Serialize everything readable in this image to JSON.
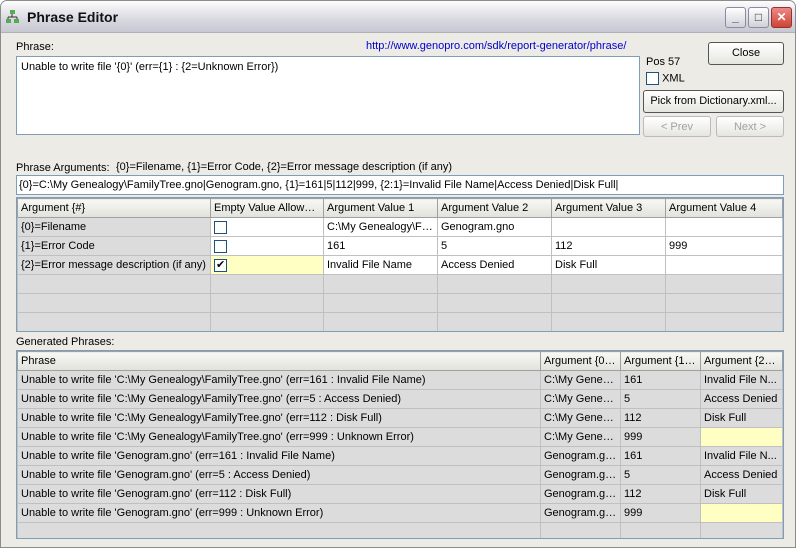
{
  "window": {
    "title": "Phrase Editor"
  },
  "phrase": {
    "label": "Phrase:",
    "link": "http://www.genopro.com/sdk/report-generator/phrase/",
    "value": "Unable to write file '{0}' (err={1} : {2=Unknown Error})",
    "pos": "Pos 57"
  },
  "buttons": {
    "close": "Close",
    "xml": "XML",
    "xml_checked": false,
    "pick": "Pick from Dictionary.xml...",
    "prev": "< Prev",
    "next": "Next >"
  },
  "arguments": {
    "label": "Phrase Arguments:",
    "hint": "{0}=Filename, {1}=Error Code, {2}=Error message description (if any)",
    "value": "{0}=C:\\My Genealogy\\FamilyTree.gno|Genogram.gno, {1}=161|5|112|999, {2:1}=Invalid File Name|Access Denied|Disk Full|",
    "columns": [
      "Argument {#}",
      "Empty Value Allowed?",
      "Argument Value 1",
      "Argument Value 2",
      "Argument Value 3",
      "Argument Value 4"
    ],
    "rows": [
      {
        "name": "{0}=Filename",
        "empty_allowed": false,
        "values": [
          "C:\\My Genealogy\\Fa...",
          "Genogram.gno",
          "",
          ""
        ]
      },
      {
        "name": "{1}=Error Code",
        "empty_allowed": false,
        "values": [
          "161",
          "5",
          "112",
          "999"
        ]
      },
      {
        "name": "{2}=Error message description (if any)",
        "empty_allowed": true,
        "values": [
          "Invalid File Name",
          "Access Denied",
          "Disk Full",
          ""
        ]
      }
    ]
  },
  "generated": {
    "label": "Generated Phrases:",
    "columns": [
      "Phrase",
      "Argument {0} ...",
      "Argument {1} ...",
      "Argument {2} ..."
    ],
    "rows": [
      [
        "Unable to write file 'C:\\My Genealogy\\FamilyTree.gno' (err=161 : Invalid File Name)",
        "C:\\My Geneal...",
        "161",
        "Invalid File N..."
      ],
      [
        "Unable to write file 'C:\\My Genealogy\\FamilyTree.gno' (err=5 : Access Denied)",
        "C:\\My Geneal...",
        "5",
        "Access Denied"
      ],
      [
        "Unable to write file 'C:\\My Genealogy\\FamilyTree.gno' (err=112 : Disk Full)",
        "C:\\My Geneal...",
        "112",
        "Disk Full"
      ],
      [
        "Unable to write file 'C:\\My Genealogy\\FamilyTree.gno' (err=999 : Unknown Error)",
        "C:\\My Geneal...",
        "999",
        ""
      ],
      [
        "Unable to write file 'Genogram.gno' (err=161 : Invalid File Name)",
        "Genogram.gno",
        "161",
        "Invalid File N..."
      ],
      [
        "Unable to write file 'Genogram.gno' (err=5 : Access Denied)",
        "Genogram.gno",
        "5",
        "Access Denied"
      ],
      [
        "Unable to write file 'Genogram.gno' (err=112 : Disk Full)",
        "Genogram.gno",
        "112",
        "Disk Full"
      ],
      [
        "Unable to write file 'Genogram.gno' (err=999 : Unknown Error)",
        "Genogram.gno",
        "999",
        ""
      ]
    ]
  }
}
